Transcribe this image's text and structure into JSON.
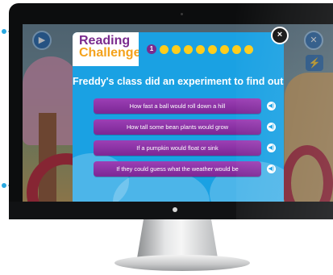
{
  "modal": {
    "logo_line1": "Reading",
    "logo_line2": "Challenge",
    "progress_current": "1",
    "progress_remaining": 8,
    "close_symbol": "×",
    "question": "Freddy's class did an experiment to find out",
    "answers": [
      "How fast a ball would roll down a hill",
      "How tall some bean plants would grow",
      "If a pumpkin would float or sink",
      "If they could guess what the weather would be"
    ]
  },
  "icons": {
    "audio": "speaker-icon",
    "audio_glyph": "◀)",
    "play_glyph": "▶",
    "bolt_glyph": "⚡",
    "bg_close_glyph": "✕"
  },
  "colors": {
    "modal_blue": "#1aa1e3",
    "answer_purple": "#8a2fa6",
    "progress_yellow": "#ffcd1c",
    "logo_purple": "#7a2a8e",
    "logo_orange": "#f4a21c"
  }
}
